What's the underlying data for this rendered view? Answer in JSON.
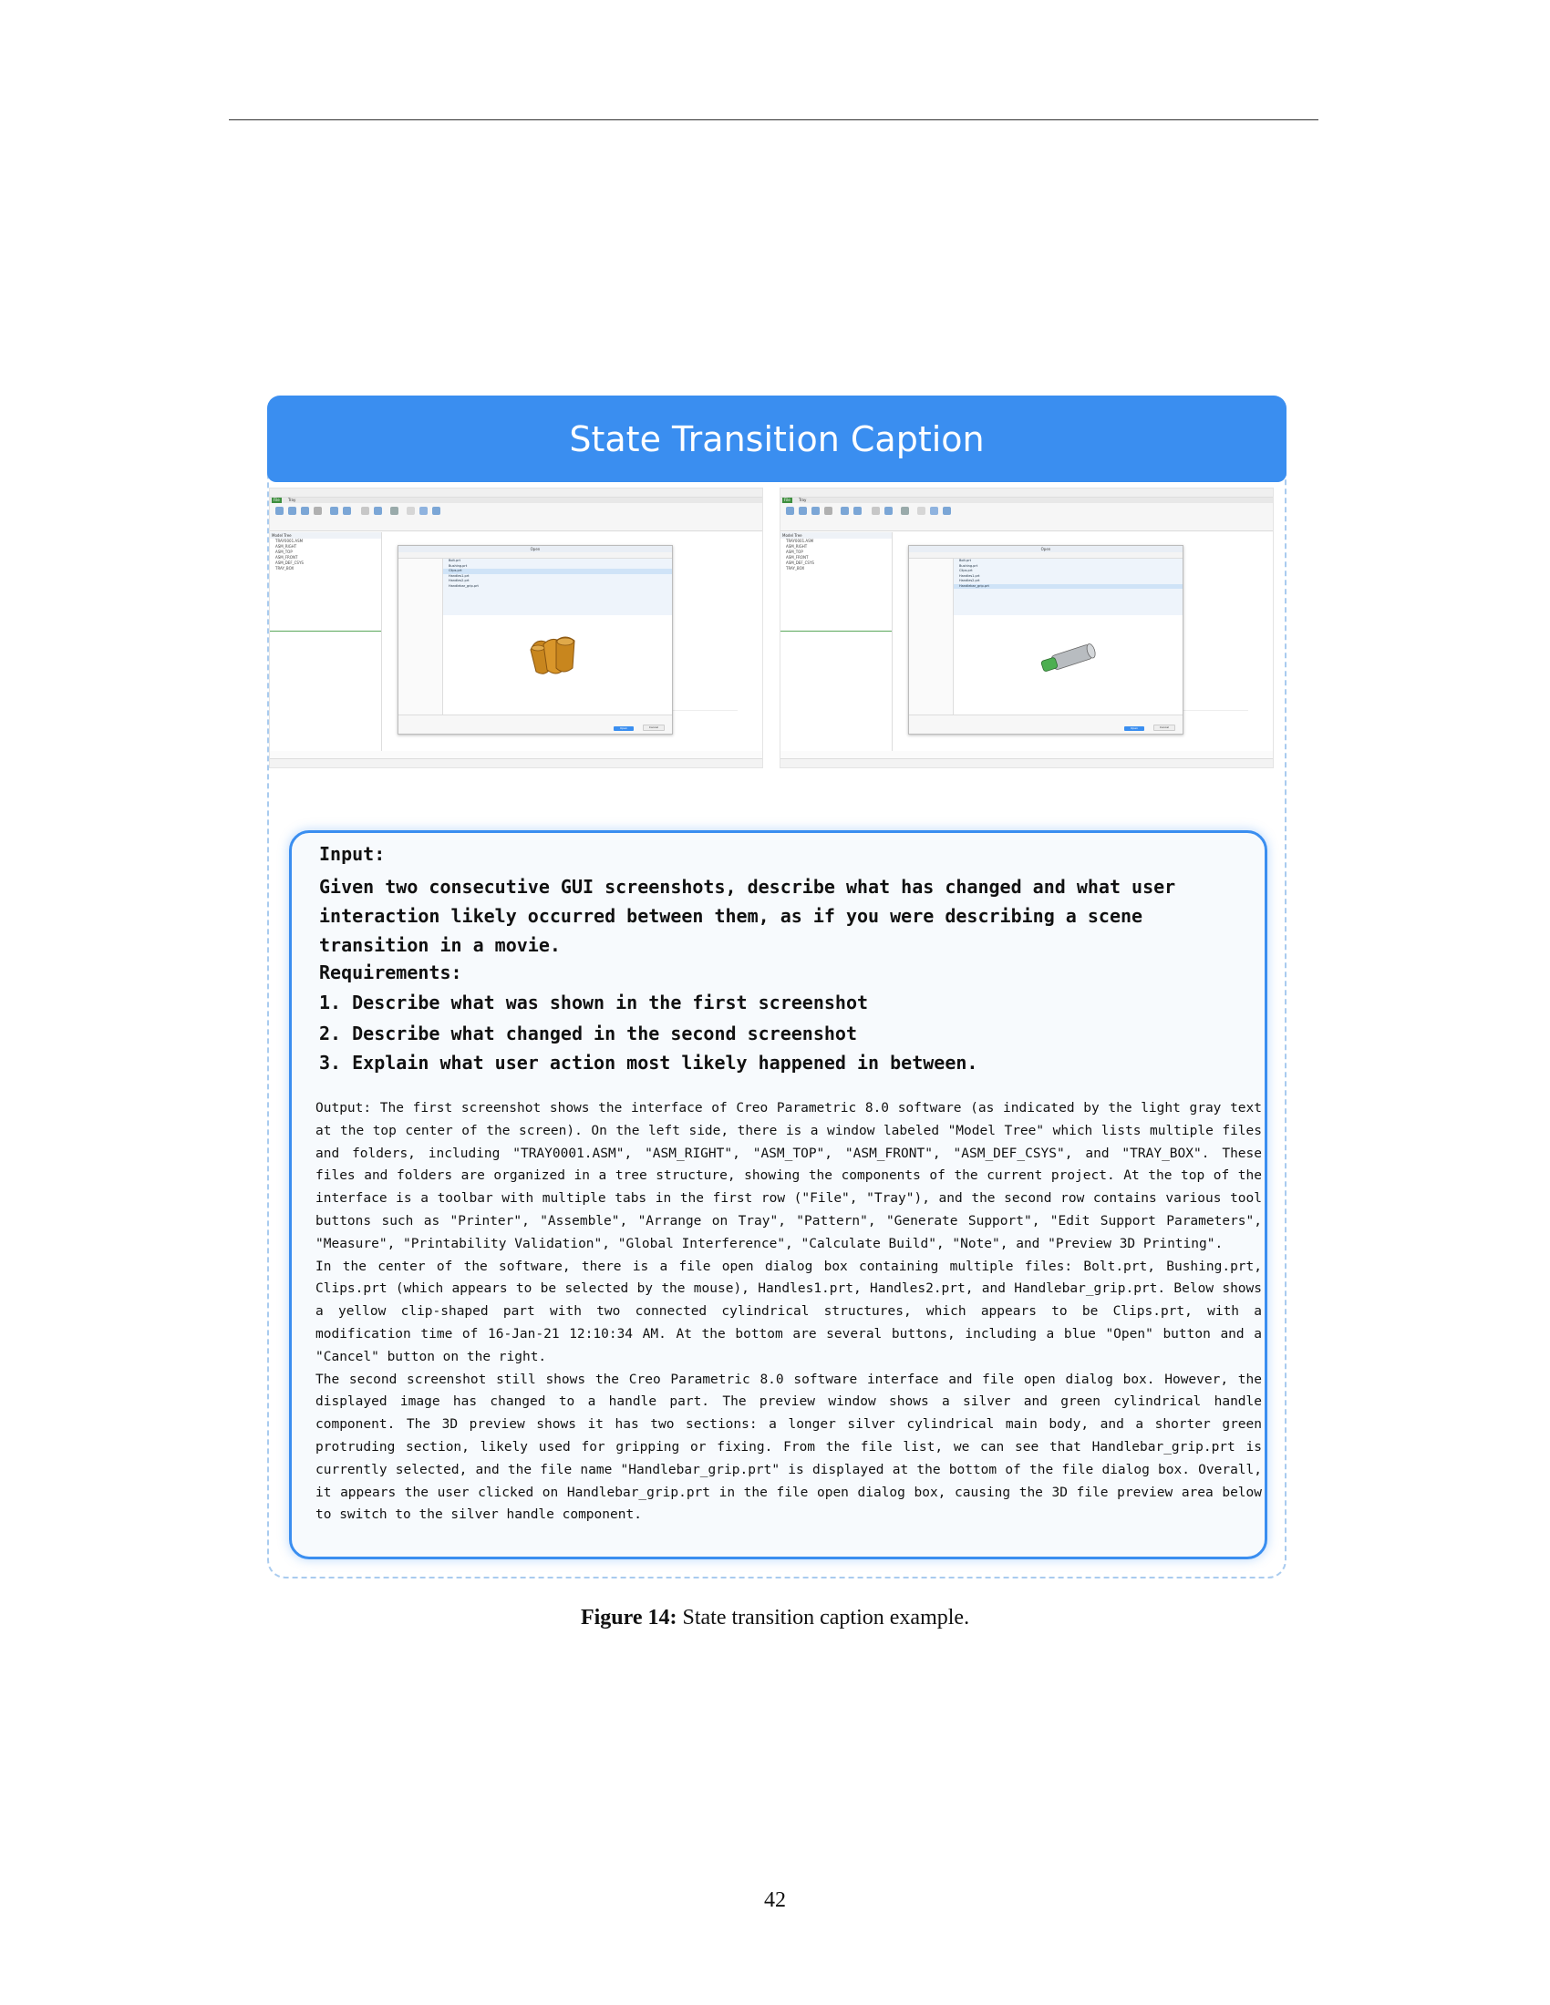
{
  "card": {
    "title": "State Transition Caption"
  },
  "screenshots": {
    "tabs": [
      "File",
      "Tray"
    ],
    "tree_header": "Model Tree",
    "tree_items": [
      "TRAY0001.ASM",
      "ASM_RIGHT",
      "ASM_TOP",
      "ASM_FRONT",
      "ASM_DEF_CSYS",
      "TRAY_BOX"
    ],
    "dialog_title": "Open",
    "files": [
      "Bolt.prt",
      "Bushing.prt",
      "Clips.prt",
      "Handles1.prt",
      "Handles2.prt",
      "Handlebar_grip.prt"
    ],
    "open_button": "Open",
    "cancel_button": "Cancel",
    "left_selected": "Clips.prt",
    "right_selected": "Handlebar_grip.prt",
    "part_color_left": "#c8861e",
    "part_color_right_main": "#b8bcc0",
    "part_color_right_grip": "#4caf50"
  },
  "input": {
    "label": "Input:",
    "prompt": "Given two consecutive GUI screenshots, describe what has changed and what user interaction likely occurred between them, as if you were describing a scene transition in a movie.",
    "requirements_label": "Requirements:",
    "requirements": [
      "1.  Describe what was shown in the first screenshot",
      "2.  Describe what changed in the second screenshot",
      "3.  Explain what user action most likely happened in between."
    ]
  },
  "output": {
    "paragraphs": [
      "Output: The first screenshot shows the interface of Creo Parametric 8.0 software (as indicated by the light gray text at the top center of the screen). On the left side, there is a window labeled \"Model Tree\" which lists multiple files and folders, including \"TRAY0001.ASM\", \"ASM_RIGHT\", \"ASM_TOP\", \"ASM_FRONT\", \"ASM_DEF_CSYS\", and \"TRAY_BOX\". These files and folders are organized in a tree structure, showing the components of the current project. At the top of the interface is a toolbar with multiple tabs in the first row (\"File\", \"Tray\"), and the second row contains various tool buttons such as \"Printer\", \"Assemble\", \"Arrange on Tray\", \"Pattern\", \"Generate Support\", \"Edit Support Parameters\", \"Measure\", \"Printability Validation\", \"Global Interference\", \"Calculate Build\", \"Note\", and \"Preview 3D Printing\".",
      "In the center of the software, there is a file open dialog box containing multiple files: Bolt.prt, Bushing.prt, Clips.prt (which appears to be selected by the mouse), Handles1.prt, Handles2.prt, and Handlebar_grip.prt. Below shows a yellow clip-shaped part with two connected cylindrical structures, which appears to be Clips.prt, with a modification time of 16-Jan-21 12:10:34 AM. At the bottom are several buttons, including a blue \"Open\" button and a \"Cancel\" button on the right.",
      "The second screenshot still shows the Creo Parametric 8.0 software interface and file open dialog box. However, the displayed image has changed to a handle part. The preview window shows a silver and green cylindrical handle component. The 3D preview shows it has two sections: a longer silver cylindrical main body, and a shorter green protruding section, likely used for gripping or fixing. From the file list, we can see that Handlebar_grip.prt is currently selected, and the file name \"Handlebar_grip.prt\" is displayed at the bottom of the file dialog box. Overall, it appears the user clicked on Handlebar_grip.prt in the file open dialog box, causing the 3D file preview area below to switch to the silver handle component."
    ]
  },
  "figure": {
    "label": "Figure 14:",
    "caption": "State transition caption example."
  },
  "page_number": "42"
}
